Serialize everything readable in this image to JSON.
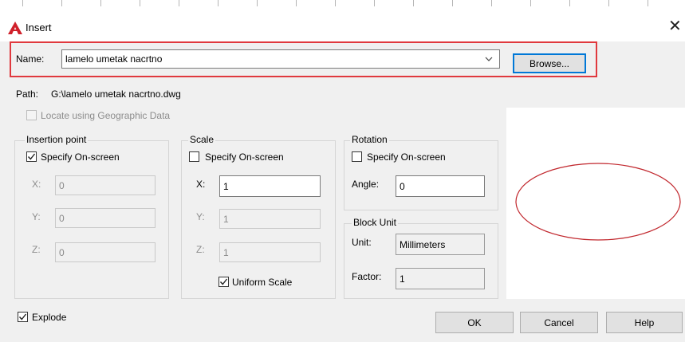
{
  "dialog": {
    "title": "Insert",
    "close_glyph": "✕",
    "icon": "autocad-logo-icon"
  },
  "name": {
    "label": "Name:",
    "value": "lamelo umetak nacrtno",
    "browse_label": "Browse..."
  },
  "path": {
    "label": "Path:",
    "value": "G:\\lamelo umetak nacrtno.dwg"
  },
  "geo": {
    "label": "Locate using Geographic Data",
    "checked": false
  },
  "insertion_point": {
    "title": "Insertion point",
    "specify_label": "Specify On-screen",
    "specify_checked": true,
    "x_label": "X:",
    "x_value": "0",
    "y_label": "Y:",
    "y_value": "0",
    "z_label": "Z:",
    "z_value": "0"
  },
  "scale": {
    "title": "Scale",
    "specify_label": "Specify On-screen",
    "specify_checked": false,
    "x_label": "X:",
    "x_value": "1",
    "y_label": "Y:",
    "y_value": "1",
    "z_label": "Z:",
    "z_value": "1",
    "uniform_label": "Uniform Scale",
    "uniform_checked": true
  },
  "rotation": {
    "title": "Rotation",
    "specify_label": "Specify On-screen",
    "specify_checked": false,
    "angle_label": "Angle:",
    "angle_value": "0"
  },
  "block_unit": {
    "title": "Block Unit",
    "unit_label": "Unit:",
    "unit_value": "Millimeters",
    "factor_label": "Factor:",
    "factor_value": "1"
  },
  "explode": {
    "label": "Explode",
    "checked": true
  },
  "buttons": {
    "ok": "OK",
    "cancel": "Cancel",
    "help": "Help"
  },
  "colors": {
    "highlight_box": "#e0393e",
    "preview_ellipse": "#c1272d",
    "default_button_border": "#0078d7"
  }
}
